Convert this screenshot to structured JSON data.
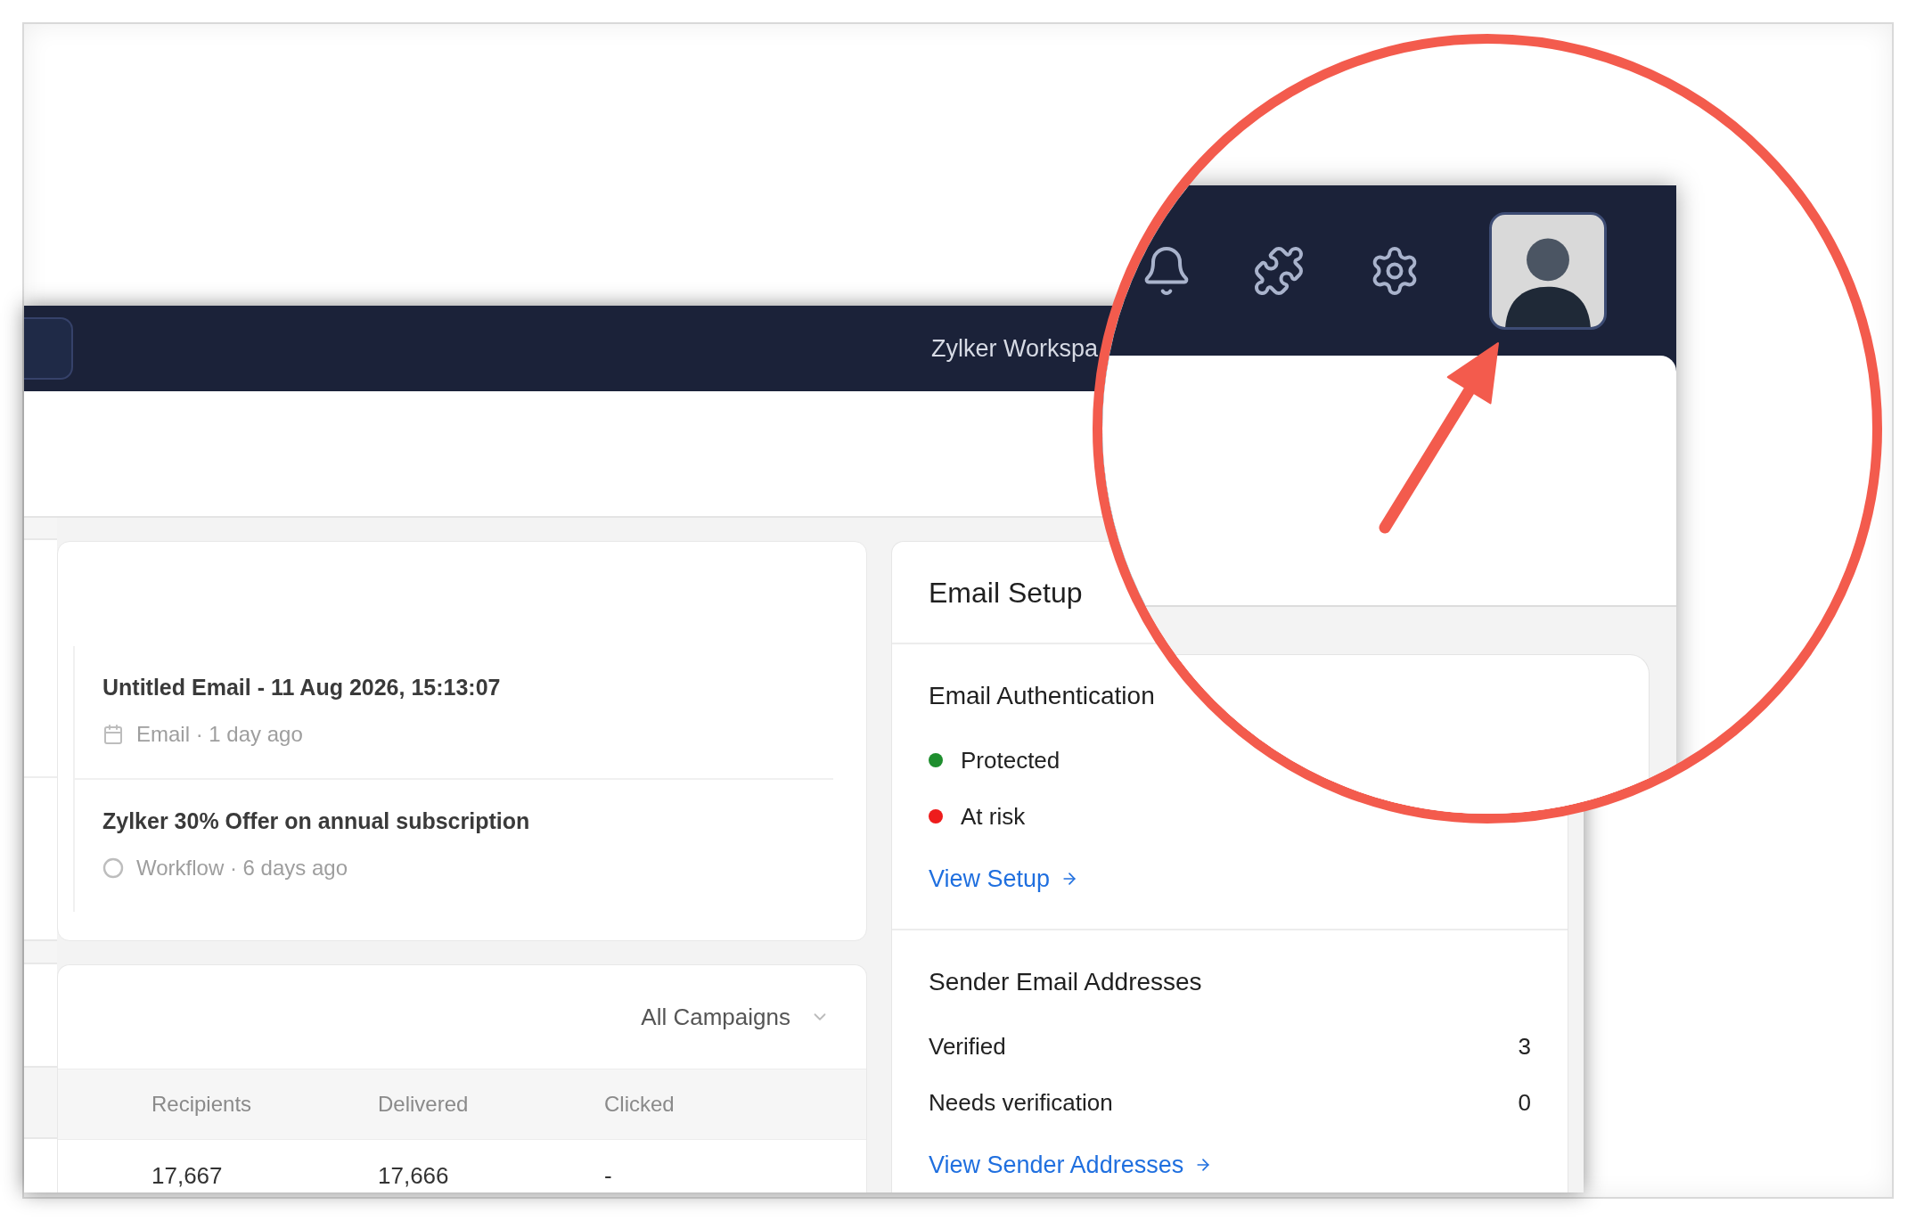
{
  "header": {
    "workspace_name": "Zylker Workspa"
  },
  "recent_items": [
    {
      "kind": "email",
      "title": "Untitled Email - 11 Aug 2026, 15:13:07",
      "meta": "Email · 1 day ago"
    },
    {
      "kind": "workflow",
      "title": "Zylker 30% Offer on annual subscription",
      "meta": "Workflow · 6 days ago"
    }
  ],
  "campaigns": {
    "filter": "All Campaigns",
    "columns": [
      "Recipients",
      "Delivered",
      "Clicked"
    ],
    "rows": [
      [
        "17,667",
        "17,666",
        "-"
      ]
    ]
  },
  "email_setup": {
    "title": "Email Setup",
    "sections": [
      {
        "title": "Email Authentication",
        "items": [
          {
            "kind": "status",
            "label": "Protected",
            "color": "#1e8e2e"
          },
          {
            "kind": "status",
            "label": "At risk",
            "color": "#ee1c1c"
          }
        ],
        "link": "View Setup"
      },
      {
        "title": "Sender Email Addresses",
        "items": [
          {
            "kind": "count",
            "label": "Verified",
            "value": "3"
          },
          {
            "kind": "count",
            "label": "Needs verification",
            "value": "0"
          }
        ],
        "link": "View Sender Addresses"
      }
    ]
  }
}
